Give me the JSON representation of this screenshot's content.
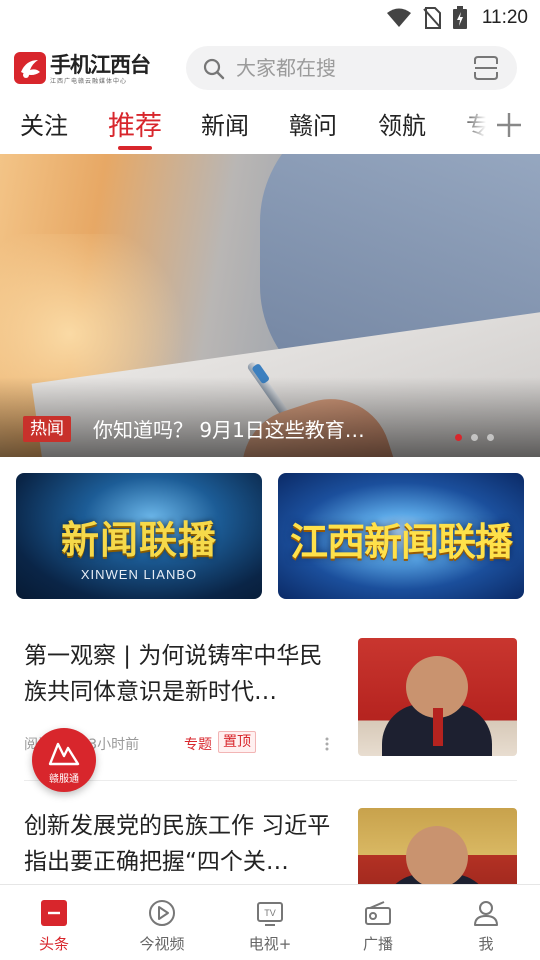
{
  "status_bar": {
    "time": "11:20"
  },
  "header": {
    "logo_text": "手机江西台",
    "logo_subtitle": "江西广电赣云融媒体中心",
    "search_placeholder": "大家都在搜"
  },
  "tabs": [
    {
      "label": "关注",
      "active": false
    },
    {
      "label": "推荐",
      "active": true
    },
    {
      "label": "新闻",
      "active": false
    },
    {
      "label": "赣问",
      "active": false
    },
    {
      "label": "领航",
      "active": false
    },
    {
      "label": "专",
      "active": false
    }
  ],
  "banner": {
    "badge": "热闻",
    "title": "你知道吗？ 9月1日这些教育…",
    "slide_count": 3,
    "active_slide": 1
  },
  "programs": [
    {
      "title": "新闻联播",
      "subtitle": "XINWEN LIANBO"
    },
    {
      "title": "江西新闻联播"
    }
  ],
  "news": [
    {
      "title": "第一观察 | 为何说铸牢中华民族共同体意识是新时代…",
      "meta": "阅读2万 13小时前",
      "topic": "专题",
      "pin": "置顶"
    },
    {
      "title": "创新发展党的民族工作 习近平指出要正确把握“四个关…"
    }
  ],
  "float_button": {
    "label": "赣服通"
  },
  "bottom_nav": [
    {
      "label": "头条",
      "icon": "headline-icon",
      "active": true
    },
    {
      "label": "今视频",
      "icon": "play-icon",
      "active": false
    },
    {
      "label": "电视+",
      "icon": "tv-icon",
      "active": false
    },
    {
      "label": "广播",
      "icon": "radio-icon",
      "active": false
    },
    {
      "label": "我",
      "icon": "user-icon",
      "active": false
    }
  ],
  "colors": {
    "accent": "#d8262c"
  }
}
